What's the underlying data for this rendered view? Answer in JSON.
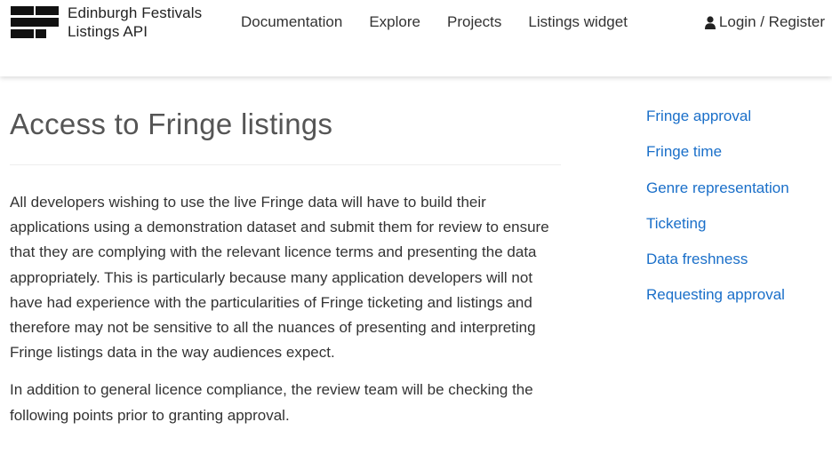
{
  "header": {
    "brand_line1": "Edinburgh Festivals",
    "brand_line2": "Listings API",
    "nav": [
      {
        "label": "Documentation"
      },
      {
        "label": "Explore"
      },
      {
        "label": "Projects"
      },
      {
        "label": "Listings widget"
      }
    ],
    "login_label": "Login / Register"
  },
  "main": {
    "title": "Access to Fringe listings",
    "paragraphs": [
      "All developers wishing to use the live Fringe data will have to build their applications using a demonstration dataset and submit them for review to ensure that they are complying with the relevant licence terms and presenting the data appropriately. This is particularly because many application developers will not have had experience with the particularities of Fringe ticketing and listings and therefore may not be sensitive to all the nuances of presenting and interpreting Fringe listings data in the way audiences expect.",
      "In addition to general licence compliance, the review team will be checking the following points prior to granting approval."
    ]
  },
  "sidebar": {
    "items": [
      {
        "label": "Fringe approval"
      },
      {
        "label": "Fringe time"
      },
      {
        "label": "Genre representation"
      },
      {
        "label": "Ticketing"
      },
      {
        "label": "Data freshness"
      },
      {
        "label": "Requesting approval"
      }
    ]
  },
  "colors": {
    "link": "#1a6fc9",
    "text": "#333333",
    "title": "#555555"
  },
  "icons": {
    "logo": "festival-grid-logo-icon",
    "login": "user-icon"
  }
}
